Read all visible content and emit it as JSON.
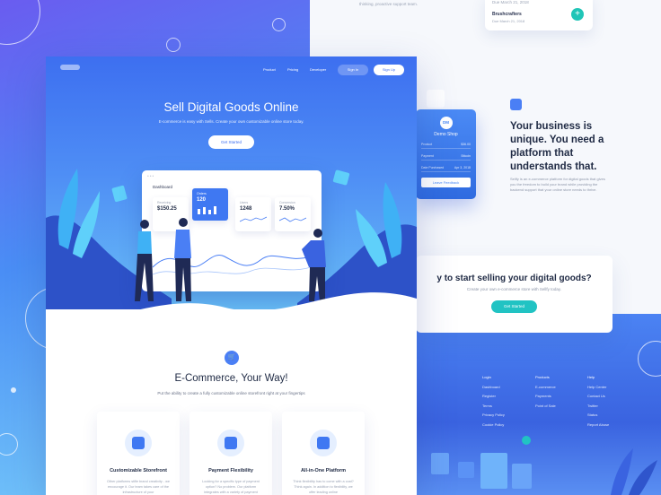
{
  "top_card": {
    "date1": "Due March 21, 2018",
    "name": "Brushcrafters",
    "date2": "Due March 21, 2018",
    "plus": "+"
  },
  "top_text": "thinking, proactive support team.",
  "shop": {
    "avatar": "DM",
    "name": "Demo Shop",
    "rows": [
      {
        "k": "Product",
        "v": "$36.00"
      },
      {
        "k": "Payment",
        "v": "Bitcoin"
      },
      {
        "k": "Date Purchased",
        "v": "Apr 3, 2018"
      }
    ],
    "button": "Leave Feedback"
  },
  "feature": {
    "title": "Your business is unique. You need a platform that understands that.",
    "desc": "Sellfy is an e-commerce platform for digital goods that gives you the freedom to build your brand while providing the backend support that your online store needs to thrive."
  },
  "sell": {
    "title": "y to start selling your digital goods?",
    "sub": "Create your own e-commerce store with Sellfy today.",
    "button": "Get Started"
  },
  "footer": {
    "col1": [
      "Login",
      "Dashboard",
      "Register",
      "Terms",
      "Privacy Policy",
      "Cookie Policy"
    ],
    "col2": [
      "Products",
      "E-commerce",
      "Payments",
      "Point of Sale"
    ],
    "col3": [
      "Help",
      "Help Center",
      "Contact Us",
      "Twitter",
      "Status",
      "Report Abuse"
    ]
  },
  "nav": {
    "links": [
      "Product",
      "Pricing",
      "Developer"
    ],
    "signin": "Sign In",
    "signup": "Sign Up"
  },
  "hero": {
    "title": "Sell Digital Goods Online",
    "sub": "E-commerce is easy with Sells. Create your own customizable online store today.",
    "button": "Get Started"
  },
  "dashboard": {
    "title": "Dashboard",
    "kpis": [
      {
        "label": "Receiving",
        "value": "$150.25"
      },
      {
        "label": "Orders",
        "value": "120"
      },
      {
        "label": "Users",
        "value": "1248"
      },
      {
        "label": "Conversion",
        "value": "7.50%"
      }
    ]
  },
  "section": {
    "title": "E-Commerce, Your Way!",
    "sub": "Put the ability to create a fully customizable online storefront right at your fingertips"
  },
  "features": [
    {
      "title": "Customizable Storefront",
      "desc": "Other platforms stifle brand creativity - we encourage it. Our team takes care of the infrastructure of your"
    },
    {
      "title": "Payment Flexibility",
      "desc": "Looking for a specific type of payment option? No problem. Our platform integrates with a variety of payment"
    },
    {
      "title": "All-in-One Platform",
      "desc": "Think flexibility has to come with a cost? Think again. In addition to flexibility, we offer leading online"
    }
  ],
  "colors": {
    "primary": "#3d6ff0",
    "accent": "#21c3c3",
    "dark": "#1f2a44"
  }
}
